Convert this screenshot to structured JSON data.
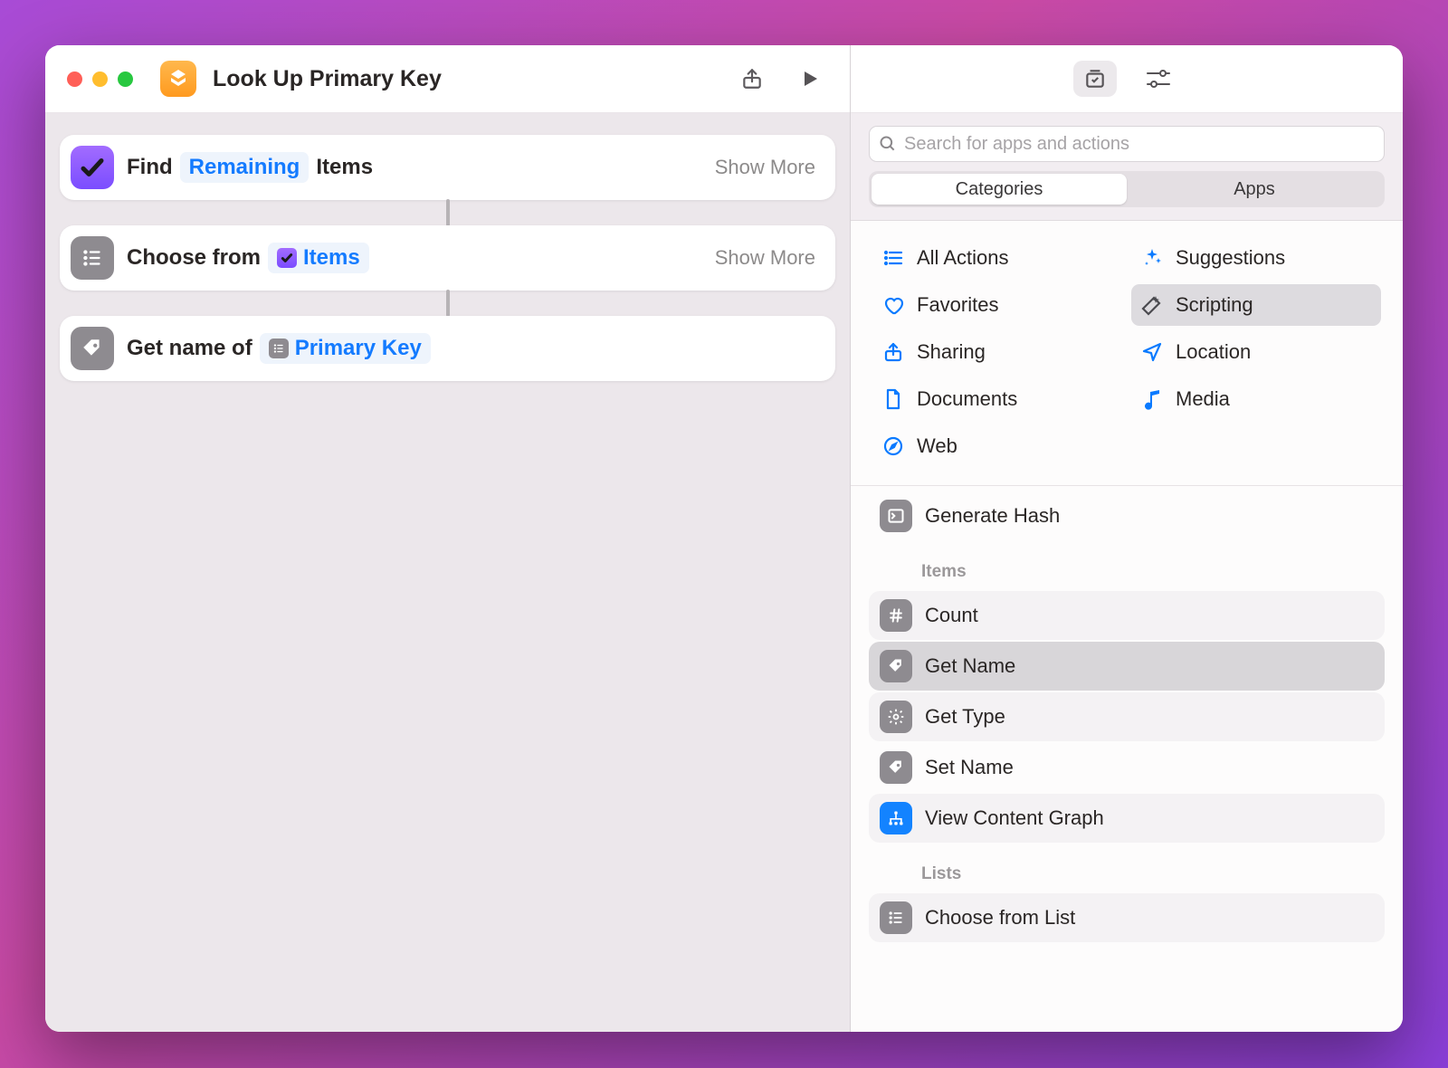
{
  "window": {
    "title": "Look Up Primary Key"
  },
  "workflow": {
    "cards": [
      {
        "verb": "Find",
        "token": "Remaining",
        "suffix": "Items",
        "show_more": "Show More"
      },
      {
        "verb": "Choose from",
        "token": "Items",
        "show_more": "Show More"
      },
      {
        "verb": "Get name of",
        "token": "Primary Key"
      }
    ]
  },
  "sidebar": {
    "search_placeholder": "Search for apps and actions",
    "tabs": {
      "categories": "Categories",
      "apps": "Apps"
    },
    "categories": [
      {
        "label": "All Actions"
      },
      {
        "label": "Suggestions"
      },
      {
        "label": "Favorites"
      },
      {
        "label": "Scripting",
        "selected": true
      },
      {
        "label": "Sharing"
      },
      {
        "label": "Location"
      },
      {
        "label": "Documents"
      },
      {
        "label": "Media"
      },
      {
        "label": "Web"
      }
    ],
    "sections": {
      "top_action": "Generate Hash",
      "items_title": "Items",
      "items": [
        {
          "label": "Count"
        },
        {
          "label": "Get Name",
          "selected": true
        },
        {
          "label": "Get Type"
        },
        {
          "label": "Set Name"
        },
        {
          "label": "View Content Graph"
        }
      ],
      "lists_title": "Lists",
      "lists": [
        {
          "label": "Choose from List"
        }
      ]
    }
  }
}
